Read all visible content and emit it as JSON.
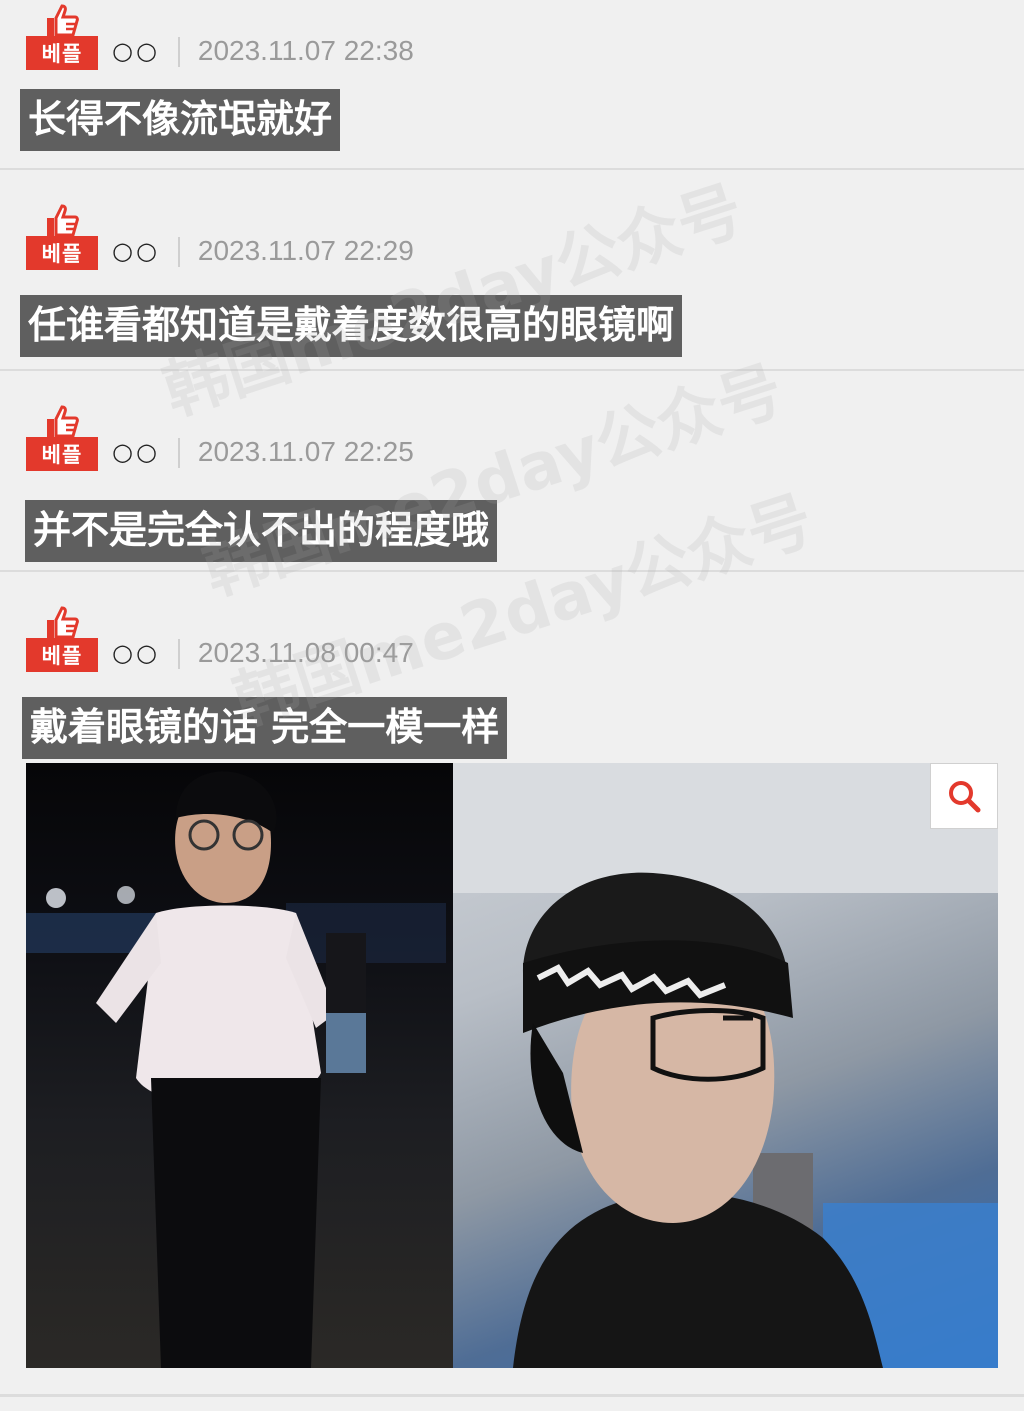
{
  "comments": [
    {
      "badge": "베플",
      "nickname": "○○",
      "timestamp": "2023.11.07 22:38",
      "text": "长得不像流氓就好"
    },
    {
      "badge": "베플",
      "nickname": "○○",
      "timestamp": "2023.11.07 22:29",
      "text": "任谁看都知道是戴着度数很高的眼镜啊"
    },
    {
      "badge": "베플",
      "nickname": "○○",
      "timestamp": "2023.11.07 22:25",
      "text": "并不是完全认不出的程度哦"
    },
    {
      "badge": "베플",
      "nickname": "○○",
      "timestamp": "2023.11.08 00:47",
      "text": "戴着眼镜的话 完全一模一样"
    }
  ],
  "watermark": "韩国me2day公众号",
  "colors": {
    "badge_red": "#e3392c",
    "caption_bg": "#5f5f5f",
    "timestamp_gray": "#9a9a9a"
  },
  "icons": {
    "badge": "thumbs-up-icon",
    "zoom": "magnifier-icon"
  }
}
